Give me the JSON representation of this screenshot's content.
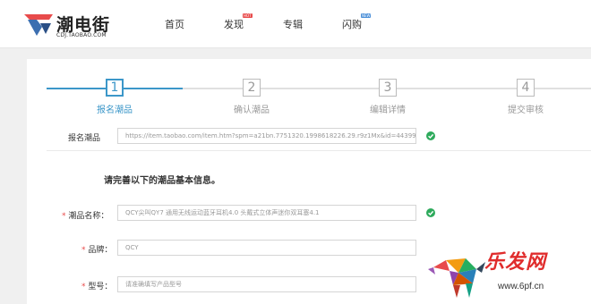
{
  "header": {
    "logo_text": "潮电街",
    "logo_subtext": "CDJ.TAOBAO.COM",
    "nav": [
      {
        "label": "首页",
        "badge": ""
      },
      {
        "label": "发现",
        "badge": "HOT"
      },
      {
        "label": "专辑",
        "badge": ""
      },
      {
        "label": "闪购",
        "badge": "NEW"
      }
    ]
  },
  "steps": [
    {
      "number": "1",
      "label": "报名潮品",
      "active": true
    },
    {
      "number": "2",
      "label": "确认潮品",
      "active": false
    },
    {
      "number": "3",
      "label": "编辑详情",
      "active": false
    },
    {
      "number": "4",
      "label": "提交审核",
      "active": false
    }
  ],
  "form": {
    "url_row": {
      "label": "报名潮品",
      "value": "https://item.taobao.com/item.htm?spm=a21bn.7751320.1998618226.29.r9z1Mx&id=44399"
    },
    "section_title": "请完善以下的潮品基本信息。",
    "name_row": {
      "required": "*",
      "label": "潮品名称",
      "colon": "：",
      "value": "QCY尖叫QY7 通用无线运动蓝牙耳机4.0 头戴式立体声迷你双耳塞4.1"
    },
    "brand_row": {
      "required": "*",
      "label": "品牌",
      "colon": "：",
      "value": "QCY"
    },
    "model_row": {
      "required": "*",
      "label": "型号",
      "colon": "：",
      "placeholder": "请准确填写产品型号"
    }
  },
  "watermark": {
    "text": "乐发网",
    "url": "www.6pf.cn"
  },
  "colors": {
    "accent": "#3c97c9",
    "check": "#2eaa5c",
    "required": "#e84b4b"
  }
}
